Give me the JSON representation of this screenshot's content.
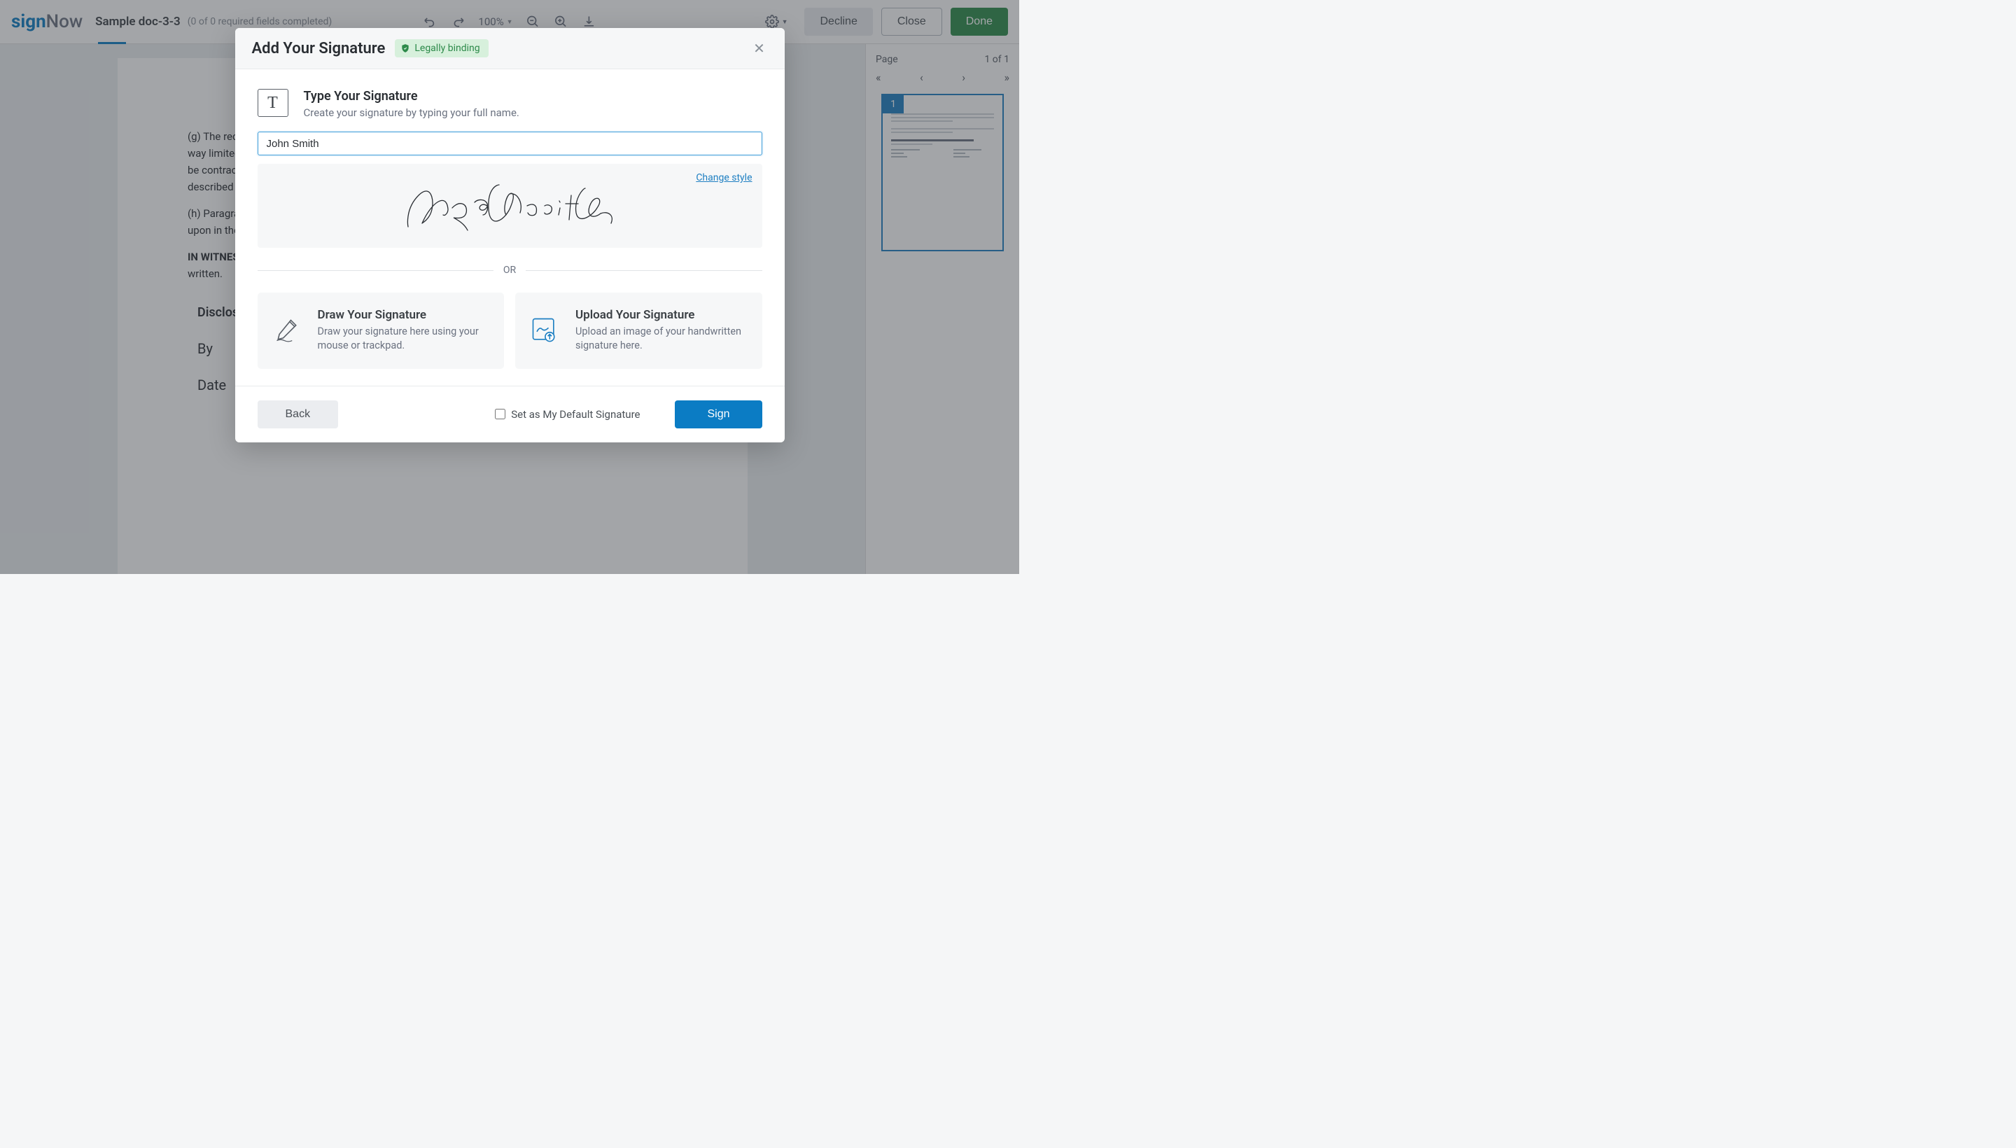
{
  "logo": {
    "sign": "sign",
    "now": "Now"
  },
  "header": {
    "docTitle": "Sample doc-3-3",
    "docStatus": "(0 of 0 required fields completed)",
    "zoom": "100%",
    "decline": "Decline",
    "close": "Close",
    "done": "Done"
  },
  "document": {
    "paraG": "(g) The recipient of the Confidential Information expressly represents and warrants that it is not in any way limited from entering into this Agreement and that by entering into this Agreement, the recipient may be contractually bound to perform in accordance with the terms hereof, relating to the receipt of services described above",
    "paraH": "(h) Paragraph headings used in this Agreement are for reference only and shall not in any way be relied upon in the interpretation of this Agreement.",
    "witness1": "IN WITNESS WHEREOF,",
    "witness2": " the parties hereto have executed this Agreement as of the date first above written.",
    "disclosing": "Disclosing Party",
    "by": "By",
    "date": "Date"
  },
  "sidebar": {
    "pageLabel": "Page",
    "pageCount": "1 of 1",
    "thumbNum": "1"
  },
  "modal": {
    "title": "Add Your Signature",
    "legalBadge": "Legally binding",
    "type": {
      "title": "Type Your Signature",
      "desc": "Create your signature by typing your full name.",
      "value": "John Smith",
      "changeStyle": "Change style"
    },
    "orDivider": "OR",
    "draw": {
      "title": "Draw Your Signature",
      "desc": "Draw your signature here using your mouse or trackpad."
    },
    "upload": {
      "title": "Upload Your Signature",
      "desc": "Upload an image of your handwritten signature here."
    },
    "footer": {
      "back": "Back",
      "defaultLabel": "Set as My Default Signature",
      "sign": "Sign"
    }
  }
}
